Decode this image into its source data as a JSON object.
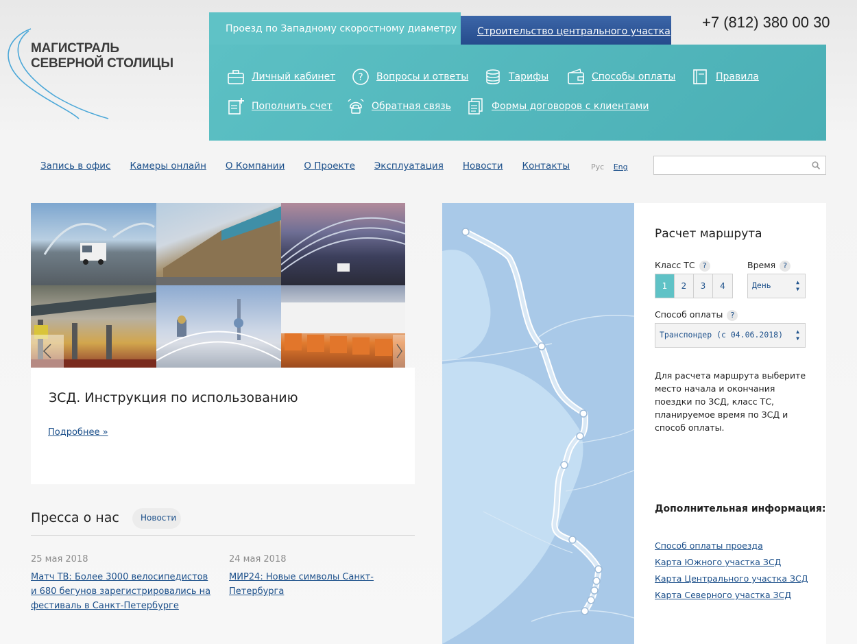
{
  "logo": {
    "line1": "МАГИСТРАЛЬ",
    "line2": "СЕВЕРНОЙ СТОЛИЦЫ"
  },
  "tabs": {
    "active": "Проезд по Западному скоростному диаметру",
    "second": "Строительство центрального участка"
  },
  "phone": "+7 (812) 380 00 30",
  "quick_links": [
    {
      "label": "Личный кабинет",
      "icon": "briefcase-icon"
    },
    {
      "label": "Вопросы и ответы",
      "icon": "question-circle-icon"
    },
    {
      "label": "Тарифы",
      "icon": "coins-icon"
    },
    {
      "label": "Способы оплаты",
      "icon": "wallet-icon"
    },
    {
      "label": "Правила",
      "icon": "book-icon"
    },
    {
      "label": "Пополнить счет",
      "icon": "add-document-icon"
    },
    {
      "label": "Обратная связь",
      "icon": "phone-icon"
    },
    {
      "label": "Формы договоров с клиентами",
      "icon": "documents-icon"
    }
  ],
  "nav": [
    "Запись в офис",
    "Камеры онлайн",
    "О Компании",
    "О Проекте",
    "Эксплуатация",
    "Новости",
    "Контакты"
  ],
  "lang": {
    "ru": "Рус",
    "en": "Eng"
  },
  "search": {
    "placeholder": ""
  },
  "article": {
    "title": "ЗСД. Инструкция по использованию",
    "more": "Подробнее »"
  },
  "press": {
    "title": "Пресса о нас",
    "tag": "Новости",
    "items": [
      {
        "date": "25 мая 2018",
        "text": "Матч ТВ: Более 3000 велосипедистов и 680 бегунов зарегистрировались на фестиваль в Санкт-Петербурге"
      },
      {
        "date": "24 мая 2018",
        "text": "МИР24: Новые символы Санкт-Петербурга"
      }
    ]
  },
  "route": {
    "title": "Расчет маршрута",
    "class_label": "Класс ТС",
    "classes": [
      "1",
      "2",
      "3",
      "4"
    ],
    "selected_class": "1",
    "time_label": "Время",
    "time_value": "День",
    "payment_label": "Способ оплаты",
    "payment_value": "Транспондер (с 04.06.2018)",
    "help": "?",
    "description": "Для расчета маршрута выберите место начала и окончания поездки по ЗСД, класс ТС, планируемое время по ЗСД и способ оплаты.",
    "more_title": "Дополнительная информация:",
    "more_links": [
      "Способ оплаты проезда",
      "Карта Южного участка ЗСД",
      "Карта Центрального участка ЗСД",
      "Карта Северного участка ЗСД"
    ]
  },
  "colors": {
    "teal": "#5fc2c6",
    "blue": "#2c5596",
    "link": "#1b4f8a",
    "map_water": "#c4def3",
    "map_land": "#a9c9e8"
  }
}
